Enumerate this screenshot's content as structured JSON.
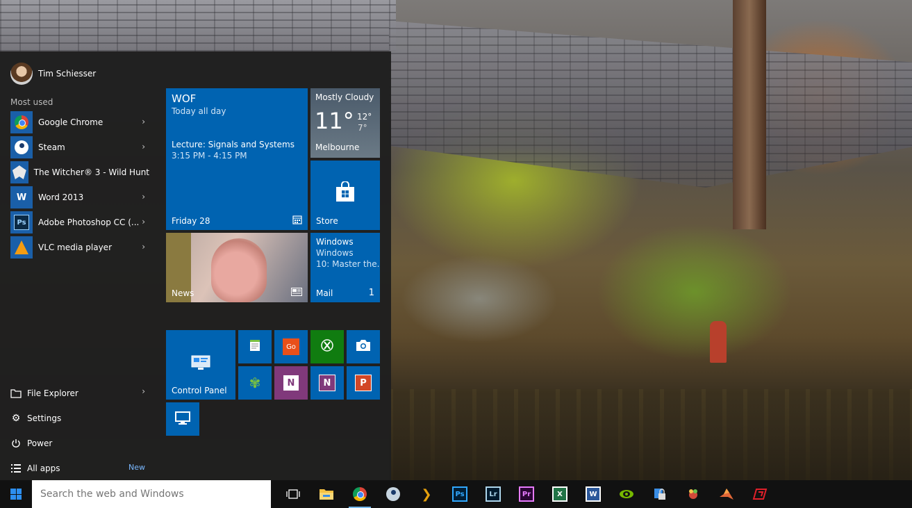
{
  "user": {
    "name": "Tim Schiesser"
  },
  "most_used": {
    "label": "Most used",
    "items": [
      {
        "label": "Google Chrome",
        "icon": "chrome-icon"
      },
      {
        "label": "Steam",
        "icon": "steam-icon"
      },
      {
        "label": "The Witcher® 3 - Wild Hunt",
        "icon": "witcher-icon"
      },
      {
        "label": "Word 2013",
        "icon": "word-icon"
      },
      {
        "label": "Adobe Photoshop CC (...",
        "icon": "photoshop-icon"
      },
      {
        "label": "VLC media player",
        "icon": "vlc-icon"
      }
    ]
  },
  "bottom": {
    "file_explorer": "File Explorer",
    "settings": "Settings",
    "power": "Power",
    "all_apps": "All apps",
    "new_badge": "New"
  },
  "tiles": {
    "calendar": {
      "title": "WOF",
      "subtitle": "Today all day",
      "event": "Lecture: Signals and Systems",
      "time": "3:15 PM - 4:15 PM",
      "date": "Friday 28"
    },
    "weather": {
      "condition": "Mostly Cloudy",
      "temp": "11°",
      "high": "12°",
      "low": "7°",
      "city": "Melbourne"
    },
    "store": {
      "label": "Store"
    },
    "news": {
      "label": "News"
    },
    "mail": {
      "line1": "Windows",
      "line2": "Windows",
      "line3": "10: Master the...",
      "label": "Mail",
      "count": "1"
    },
    "control_panel": {
      "label": "Control Panel"
    }
  },
  "taskbar": {
    "search_placeholder": "Search the web and Windows",
    "icons": [
      "task-view-icon",
      "file-explorer-icon",
      "chrome-icon",
      "steam-icon",
      "plex-icon",
      "photoshop-icon",
      "lightroom-icon",
      "premiere-icon",
      "excel-icon",
      "word-icon",
      "nvidia-icon",
      "security-icon",
      "game-icon",
      "matlab-icon",
      "red-app-icon"
    ],
    "labels": {
      "ps": "Ps",
      "lr": "Lr",
      "pr": "Pr",
      "x": "X",
      "w": "W"
    }
  },
  "colors": {
    "accent": "#0063b1",
    "tile_green": "#107c10",
    "tile_purple": "#80397b",
    "tile_orange": "#d24726"
  }
}
